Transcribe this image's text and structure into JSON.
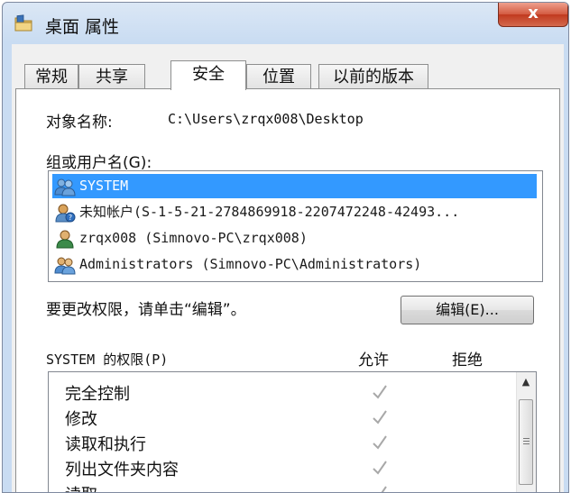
{
  "window": {
    "title": "桌面 属性",
    "close_glyph": "x"
  },
  "tabs": [
    {
      "label": "常规"
    },
    {
      "label": "共享"
    },
    {
      "label": "安全"
    },
    {
      "label": "位置"
    },
    {
      "label": "以前的版本"
    }
  ],
  "active_tab": "安全",
  "object": {
    "label": "对象名称:",
    "value": "C:\\Users\\zrqx008\\Desktop"
  },
  "groups": {
    "label": "组或用户名(G):",
    "items": [
      {
        "name": "SYSTEM",
        "icon": "users-group-icon",
        "selected": true
      },
      {
        "name": "未知帐户(S-1-5-21-2784869918-2207472248-42493...",
        "icon": "unknown-user-icon",
        "selected": false
      },
      {
        "name": "zrqx008 (Simnovo-PC\\zrqx008)",
        "icon": "user-icon",
        "selected": false
      },
      {
        "name": "Administrators (Simnovo-PC\\Administrators)",
        "icon": "users-group-icon",
        "selected": false
      }
    ]
  },
  "change_hint": "要更改权限，请单击“编辑”。",
  "edit_button": "编辑(E)...",
  "permissions": {
    "label": "SYSTEM 的权限(P)",
    "allow_header": "允许",
    "deny_header": "拒绝",
    "rows": [
      {
        "name": "完全控制",
        "allow": true,
        "deny": false
      },
      {
        "name": "修改",
        "allow": true,
        "deny": false
      },
      {
        "name": "读取和执行",
        "allow": true,
        "deny": false
      },
      {
        "name": "列出文件夹内容",
        "allow": true,
        "deny": false
      },
      {
        "name": "读取",
        "allow": true,
        "deny": false
      }
    ]
  }
}
